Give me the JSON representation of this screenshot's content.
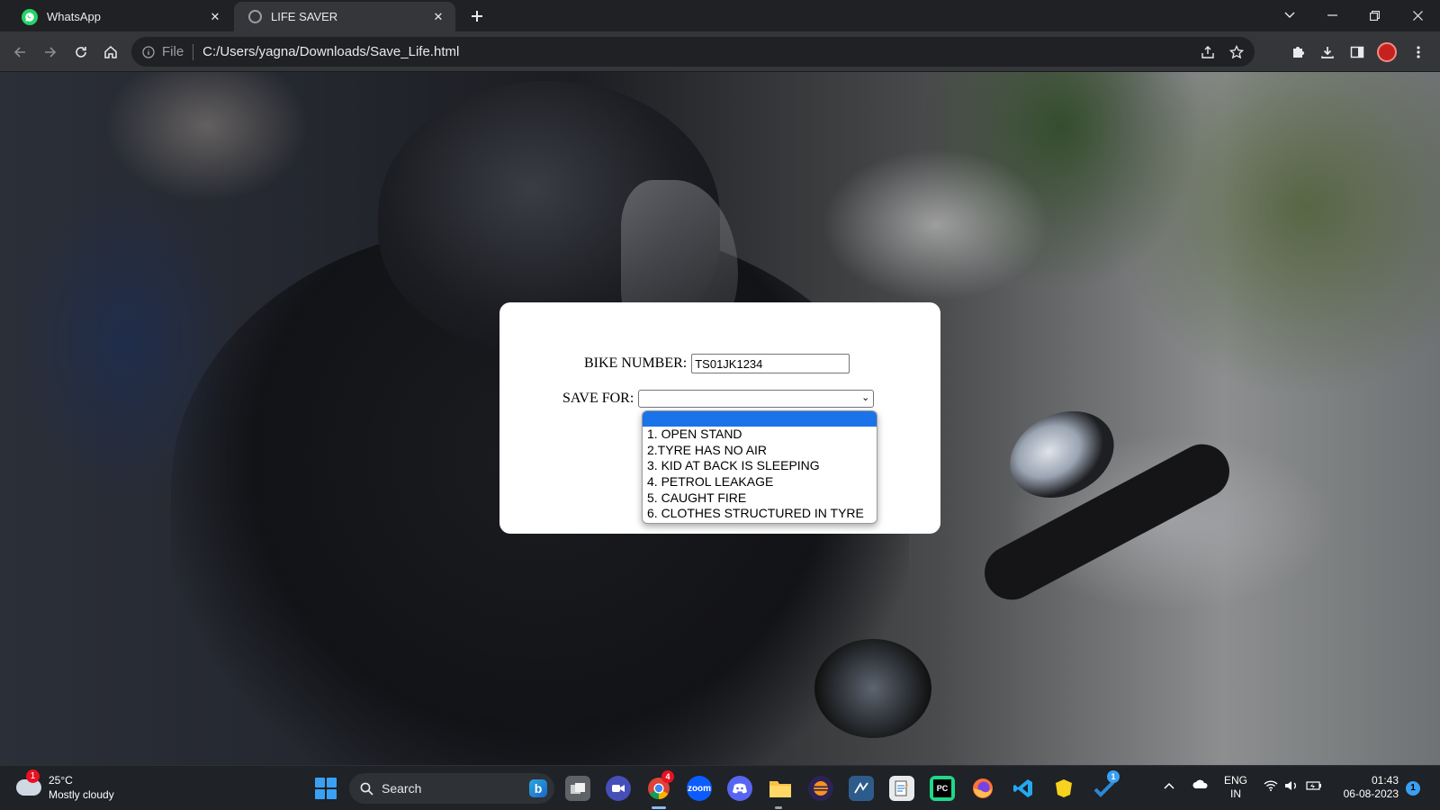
{
  "browser": {
    "tabs": [
      {
        "title": "WhatsApp",
        "active": false
      },
      {
        "title": "LIFE SAVER",
        "active": true
      }
    ],
    "address": {
      "scheme_label": "File",
      "url": "C:/Users/yagna/Downloads/Save_Life.html"
    }
  },
  "form": {
    "bike_label": "BIKE NUMBER:",
    "bike_value": "TS01JK1234",
    "save_label": "SAVE FOR:",
    "selected_option": "",
    "options": [
      "",
      "1. OPEN STAND",
      "2.TYRE HAS NO AIR",
      "3. KID AT BACK IS SLEEPING",
      "4. PETROL LEAKAGE",
      "5. CAUGHT FIRE",
      "6. CLOTHES STRUCTURED IN TYRE"
    ]
  },
  "taskbar": {
    "weather_badge": "1",
    "temperature": "25°C",
    "condition": "Mostly cloudy",
    "search_placeholder": "Search",
    "chrome_badge": "4",
    "sticky_badge": "1",
    "language_top": "ENG",
    "language_bottom": "IN",
    "time": "01:43",
    "date": "06-08-2023",
    "notification_count": "1"
  },
  "colors": {
    "accent": "#1a73e8",
    "tab_bg": "#202124",
    "toolbar_bg": "#35363a",
    "taskbar_bg": "#1f2226"
  }
}
